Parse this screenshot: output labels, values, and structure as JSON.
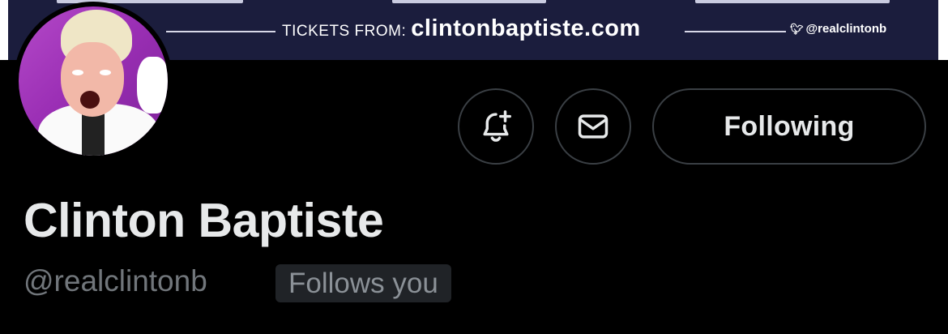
{
  "banner": {
    "tickets_label": "TICKETS FROM:",
    "tickets_url": "clintonbaptiste.com",
    "handle": "@realclintonb",
    "bird_icon": "twitter-bird-icon"
  },
  "profile": {
    "display_name": "Clinton Baptiste",
    "handle": "@realclintonb",
    "follows_you": "Follows you",
    "avatar_icon": "profile-photo"
  },
  "actions": {
    "notify_icon": "bell-plus-icon",
    "message_icon": "envelope-icon",
    "following_label": "Following"
  },
  "colors": {
    "background": "#000000",
    "text_primary": "#e7e9ea",
    "text_secondary": "#71767b",
    "button_border": "#3a3f44",
    "badge_bg": "#202327",
    "banner_bg": "#1b1d3d"
  }
}
